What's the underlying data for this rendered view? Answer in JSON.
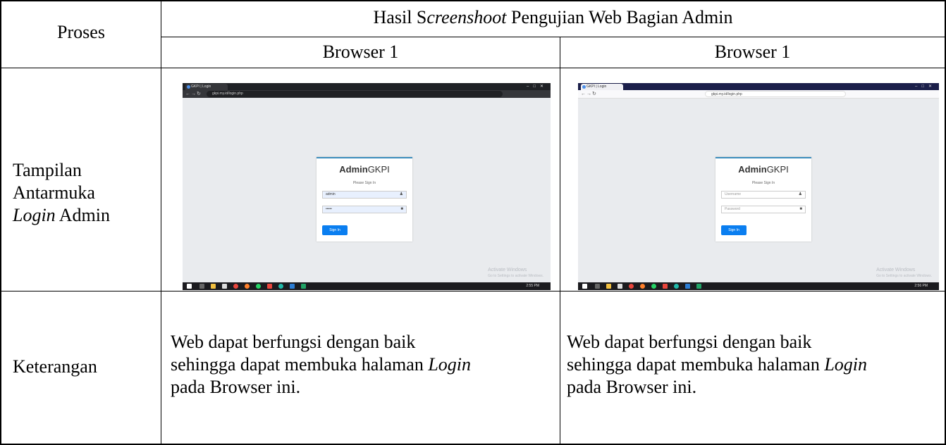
{
  "table": {
    "header_col1": "Proses",
    "header_main": {
      "prefix": "Hasil S",
      "italic": "creenshoot",
      "suffix": " Pengujian Web Bagian Admin"
    },
    "col_b1": "Browser 1",
    "col_b2": "Browser 1",
    "row1_label": {
      "line1": "Tampilan",
      "line2": "Antarmuka",
      "line3_italic": "Login",
      "line3_rest": " Admin"
    },
    "row2_label": "Keterangan",
    "row2_text": {
      "line1": "Web dapat berfungsi dengan baik",
      "line2_prefix": "sehingga dapat membuka halaman ",
      "line2_italic": "Login",
      "line3": "pada Browser ini."
    }
  },
  "screenshots": [
    {
      "tab_title": "GKPI | Login",
      "url": "gkpi.my.id/login.php",
      "brand_bold": "Admin",
      "brand_rest": "GKPI",
      "message": "Please Sign In",
      "username_value": "admin",
      "password_value": "•••••",
      "button": "Sign In",
      "watermark": "Activate Windows",
      "watermark_sub": "Go to Settings to activate Windows.",
      "clock": "2:55 PM"
    },
    {
      "tab_title": "GKPI | Login",
      "url": "gkpi.my.id/login.php",
      "brand_bold": "Admin",
      "brand_rest": "GKPI",
      "message": "Please Sign In",
      "username_placeholder": "Username",
      "password_placeholder": "Password",
      "button": "Sign In",
      "watermark": "Activate Windows",
      "watermark_sub": "Go to Settings to activate Windows.",
      "clock": "2:56 PM"
    }
  ],
  "icons": {
    "user": "user-icon",
    "lock": "lock-icon"
  }
}
